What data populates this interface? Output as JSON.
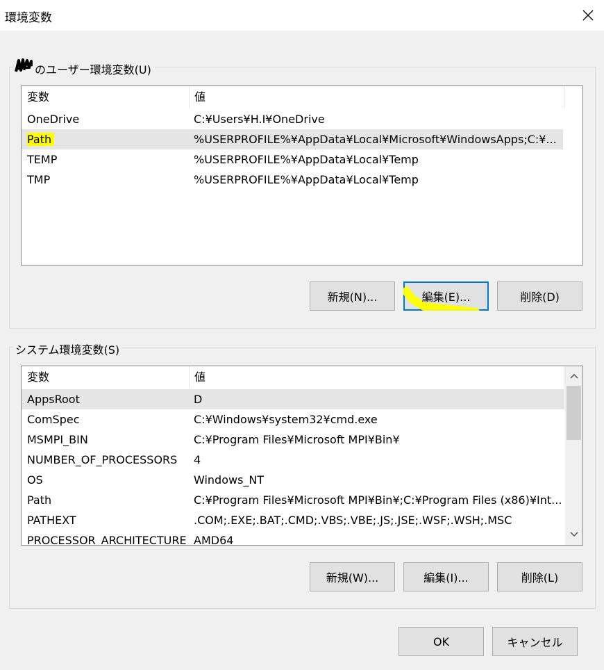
{
  "window": {
    "title": "環境変数",
    "close_icon": "close-icon"
  },
  "user_vars": {
    "group_label": "のユーザー環境変数(U)",
    "columns": [
      "変数",
      "値"
    ],
    "rows": [
      {
        "name": "OneDrive",
        "value": "C:¥Users¥H.I¥OneDrive"
      },
      {
        "name": "Path",
        "value": "%USERPROFILE%¥AppData¥Local¥Microsoft¥WindowsApps;C:¥..."
      },
      {
        "name": "TEMP",
        "value": "%USERPROFILE%¥AppData¥Local¥Temp"
      },
      {
        "name": "TMP",
        "value": "%USERPROFILE%¥AppData¥Local¥Temp"
      }
    ],
    "buttons": {
      "new": "新規(N)...",
      "edit": "編集(E)...",
      "delete": "削除(D)"
    }
  },
  "system_vars": {
    "group_label": "システム環境変数(S)",
    "columns": [
      "変数",
      "値"
    ],
    "rows": [
      {
        "name": "AppsRoot",
        "value": "D"
      },
      {
        "name": "ComSpec",
        "value": "C:¥Windows¥system32¥cmd.exe"
      },
      {
        "name": "MSMPI_BIN",
        "value": "C:¥Program Files¥Microsoft MPI¥Bin¥"
      },
      {
        "name": "NUMBER_OF_PROCESSORS",
        "value": "4"
      },
      {
        "name": "OS",
        "value": "Windows_NT"
      },
      {
        "name": "Path",
        "value": "C:¥Program Files¥Microsoft MPI¥Bin¥;C:¥Program Files (x86)¥Int..."
      },
      {
        "name": "PATHEXT",
        "value": ".COM;.EXE;.BAT;.CMD;.VBS;.VBE;.JS;.JSE;.WSF;.WSH;.MSC"
      },
      {
        "name": "PROCESSOR_ARCHITECTURE",
        "value": "AMD64"
      }
    ],
    "buttons": {
      "new": "新規(W)...",
      "edit": "編集(I)...",
      "delete": "削除(L)"
    }
  },
  "footer": {
    "ok": "OK",
    "cancel": "キャンセル"
  },
  "colors": {
    "highlight": "#ffff00",
    "focus_border": "#0078d7",
    "selected_row": "#e5e5e5"
  }
}
